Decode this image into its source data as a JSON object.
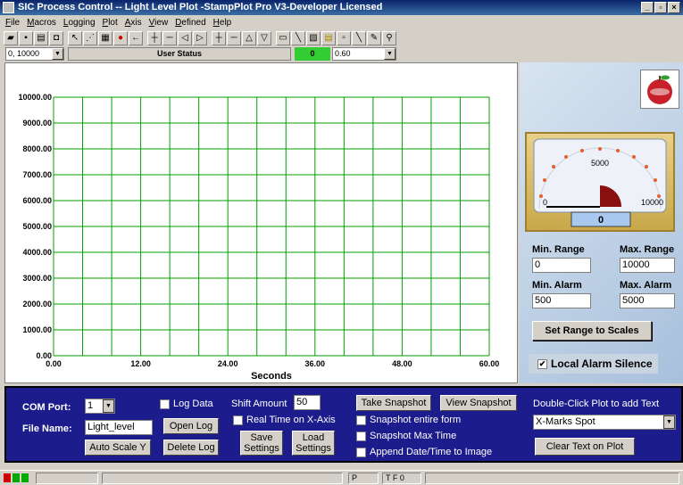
{
  "window": {
    "title": "SIC Process Control -- Light Level Plot  -StampPlot Pro V3-Developer Licensed"
  },
  "menu": [
    "File",
    "Macros",
    "Logging",
    "Plot",
    "Axis",
    "View",
    "Defined",
    "Help"
  ],
  "statusrow": {
    "combo_value": "0, 10000",
    "user_status": "User Status",
    "green_value": "0",
    "rate_value": "0.60"
  },
  "chart_data": {
    "type": "line",
    "x_ticks": [
      "0.00",
      "12.00",
      "24.00",
      "36.00",
      "48.00",
      "60.00"
    ],
    "y_ticks": [
      "0.00",
      "1000.00",
      "2000.00",
      "3000.00",
      "4000.00",
      "5000.00",
      "6000.00",
      "7000.00",
      "8000.00",
      "9000.00",
      "10000.00"
    ],
    "xlim": [
      0,
      60
    ],
    "ylim": [
      0,
      10000
    ],
    "xlabel": "Seconds",
    "ylabel": "",
    "grid": true,
    "grid_color": "#00a000",
    "series": []
  },
  "gauge": {
    "label_mid": "5000",
    "label_min": "0",
    "label_max": "10000",
    "value": "0"
  },
  "range": {
    "min_range_label": "Min. Range",
    "min_range_value": "0",
    "max_range_label": "Max. Range",
    "max_range_value": "10000",
    "min_alarm_label": "Min. Alarm",
    "min_alarm_value": "500",
    "max_alarm_label": "Max. Alarm",
    "max_alarm_value": "5000",
    "set_range_label": "Set Range to Scales",
    "local_alarm_label": "Local Alarm Silence",
    "local_alarm_checked": "✔"
  },
  "controls": {
    "com_port_label": "COM Port:",
    "com_port_value": "1",
    "file_name_label": "File Name:",
    "file_name_value": "Light_level",
    "log_data_label": "Log Data",
    "open_log_label": "Open Log",
    "auto_scale_label": "Auto Scale Y",
    "delete_log_label": "Delete Log",
    "shift_amount_label": "Shift Amount",
    "shift_amount_value": "50",
    "realtime_label": "Real Time on X-Axis",
    "save_settings_label": "Save Settings",
    "load_settings_label": "Load Settings",
    "take_snapshot_label": "Take Snapshot",
    "view_snapshot_label": "View Snapshot",
    "snapshot_entire_label": "Snapshot entire form",
    "snapshot_max_label": "Snapshot Max Time",
    "append_date_label": "Append Date/Time to Image",
    "double_click_label": "Double-Click Plot to add Text",
    "text_combo_value": "X-Marks Spot",
    "clear_text_label": "Clear Text on Plot"
  },
  "statusbar": {
    "pane_p": "P",
    "pane_tf": "T F 0"
  }
}
